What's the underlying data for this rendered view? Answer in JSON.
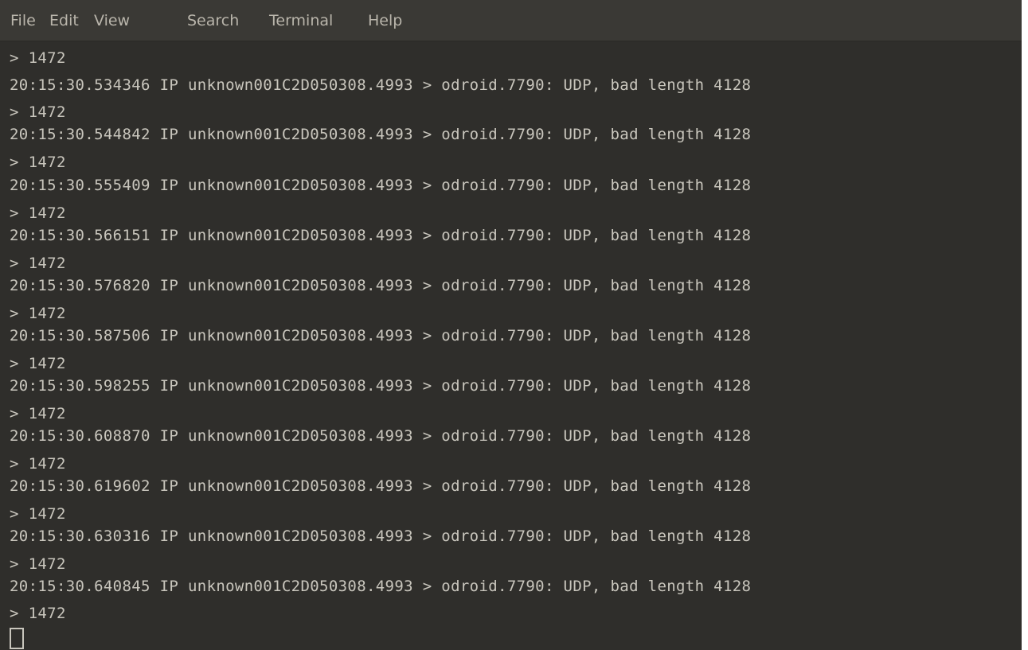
{
  "menubar": {
    "items": [
      "File",
      "Edit",
      "View",
      "Search",
      "Terminal",
      "Help"
    ]
  },
  "terminal": {
    "lines": [
      "> 1472",
      "20:15:30.534346 IP unknown001C2D050308.4993 > odroid.7790: UDP, bad length 4128",
      "> 1472",
      "20:15:30.544842 IP unknown001C2D050308.4993 > odroid.7790: UDP, bad length 4128",
      "> 1472",
      "20:15:30.555409 IP unknown001C2D050308.4993 > odroid.7790: UDP, bad length 4128",
      "> 1472",
      "20:15:30.566151 IP unknown001C2D050308.4993 > odroid.7790: UDP, bad length 4128",
      "> 1472",
      "20:15:30.576820 IP unknown001C2D050308.4993 > odroid.7790: UDP, bad length 4128",
      "> 1472",
      "20:15:30.587506 IP unknown001C2D050308.4993 > odroid.7790: UDP, bad length 4128",
      "> 1472",
      "20:15:30.598255 IP unknown001C2D050308.4993 > odroid.7790: UDP, bad length 4128",
      "> 1472",
      "20:15:30.608870 IP unknown001C2D050308.4993 > odroid.7790: UDP, bad length 4128",
      "> 1472",
      "20:15:30.619602 IP unknown001C2D050308.4993 > odroid.7790: UDP, bad length 4128",
      "> 1472",
      "20:15:30.630316 IP unknown001C2D050308.4993 > odroid.7790: UDP, bad length 4128",
      "> 1472",
      "20:15:30.640845 IP unknown001C2D050308.4993 > odroid.7790: UDP, bad length 4128",
      "> 1472"
    ]
  },
  "colors": {
    "background": "#2f2e2b",
    "menubar": "#3a3935",
    "text": "#c9c6bd",
    "menu_text": "#b9b5ab"
  }
}
